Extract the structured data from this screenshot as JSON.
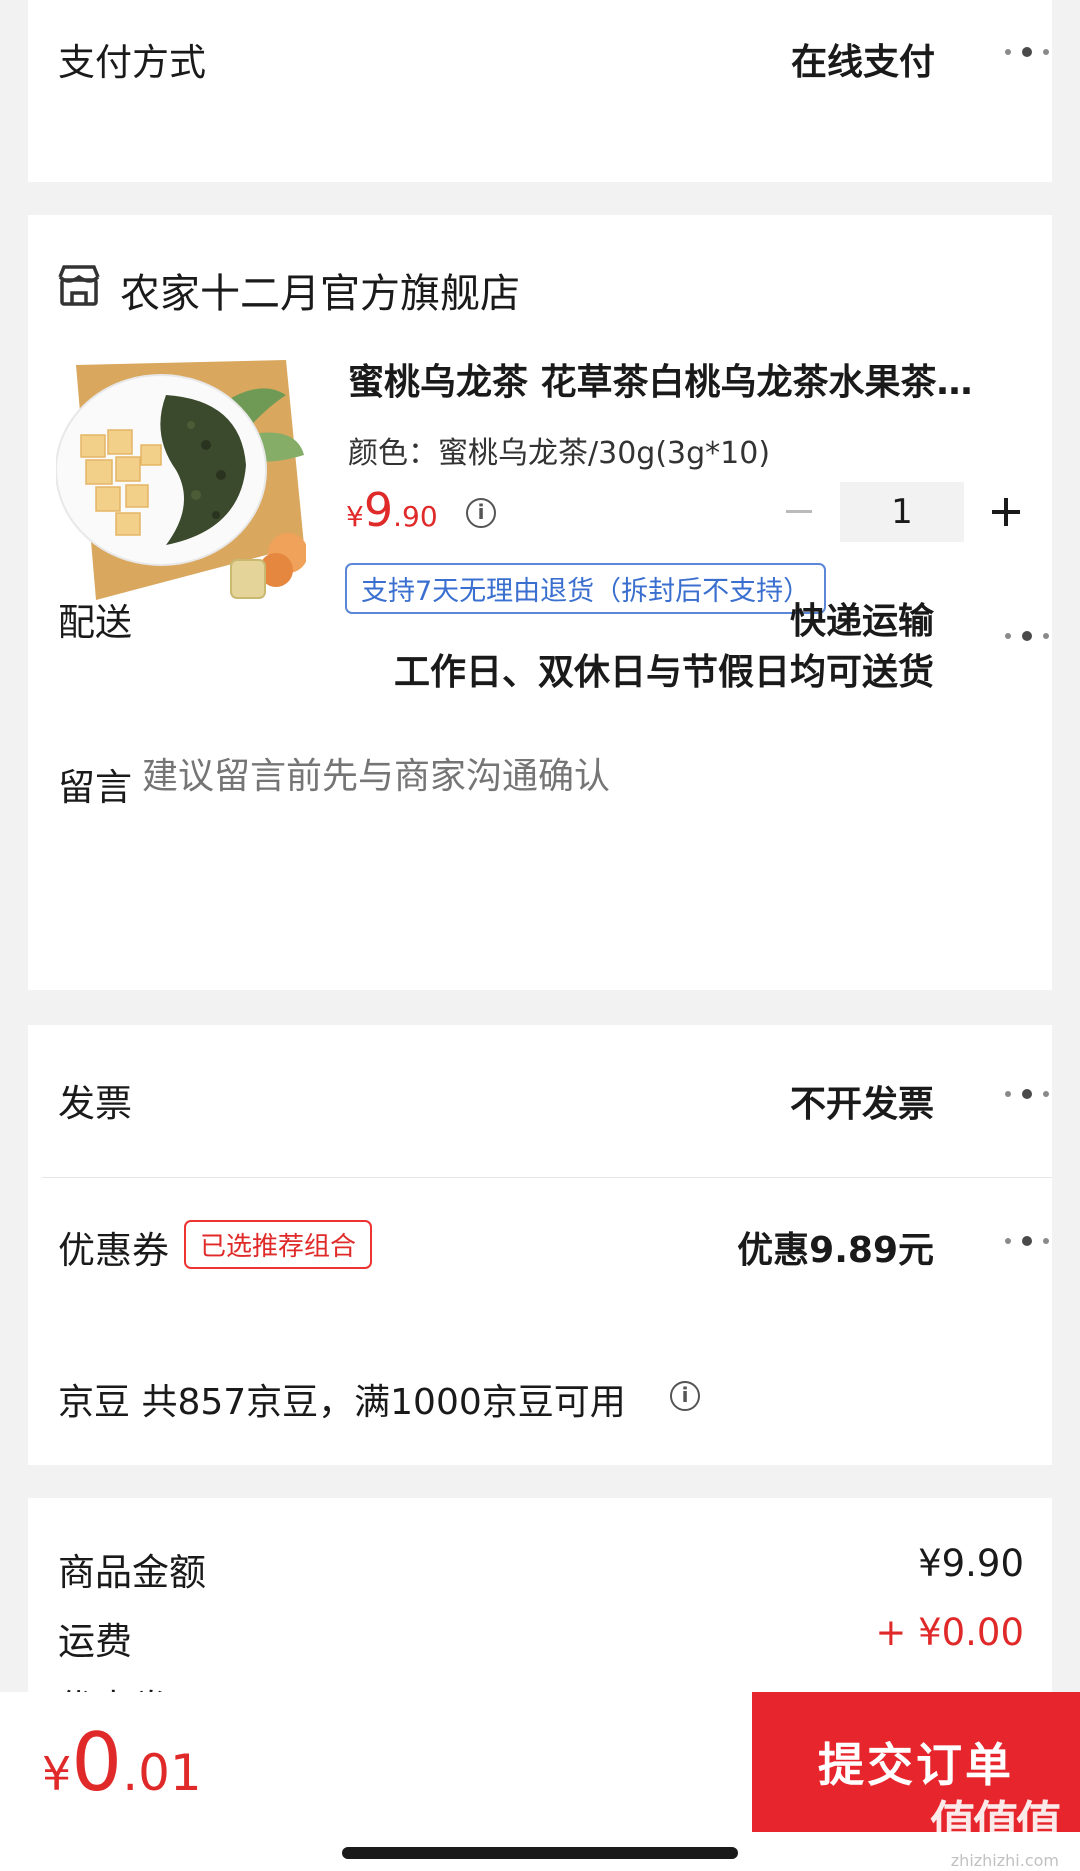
{
  "payment": {
    "label": "支付方式",
    "value": "在线支付"
  },
  "store": {
    "name": "农家十二月官方旗舰店",
    "product": {
      "title": "蜜桃乌龙茶 花草茶白桃乌龙茶水果茶…",
      "spec": "颜色：蜜桃乌龙茶/30g(3g*10)",
      "price_symbol": "¥",
      "price_int": "9",
      "price_dec": ".90",
      "quantity": "1",
      "return_policy": "支持7天无理由退货（拆封后不支持）"
    },
    "delivery": {
      "label": "配送",
      "method": "快递运输",
      "schedule": "工作日、双休日与节假日均可送货"
    },
    "message": {
      "label": "留言",
      "placeholder": "建议留言前先与商家沟通确认"
    }
  },
  "invoice": {
    "label": "发票",
    "value": "不开发票"
  },
  "coupon": {
    "label": "优惠券",
    "tag": "已选推荐组合",
    "value": "优惠9.89元"
  },
  "jingdou": {
    "text": "京豆 共857京豆，满1000京豆可用"
  },
  "summary": {
    "goods_label": "商品金额",
    "goods_value": "¥9.90",
    "shipping_label": "运费",
    "shipping_value": "+ ¥0.00",
    "discount_label_partial": "优惠券"
  },
  "footer": {
    "total_symbol": "¥",
    "total_int": "0",
    "total_dec": ".01",
    "submit_label": "提交订单",
    "watermark": "值值值",
    "watermark_url": "zhizhizhi.com"
  },
  "colors": {
    "accent": "#e6262c",
    "price": "#e02a2a",
    "link_blue": "#3a6fd0"
  },
  "icons": {
    "store": "store-icon",
    "info": "info-circle-icon",
    "more": "more-dots-icon"
  }
}
